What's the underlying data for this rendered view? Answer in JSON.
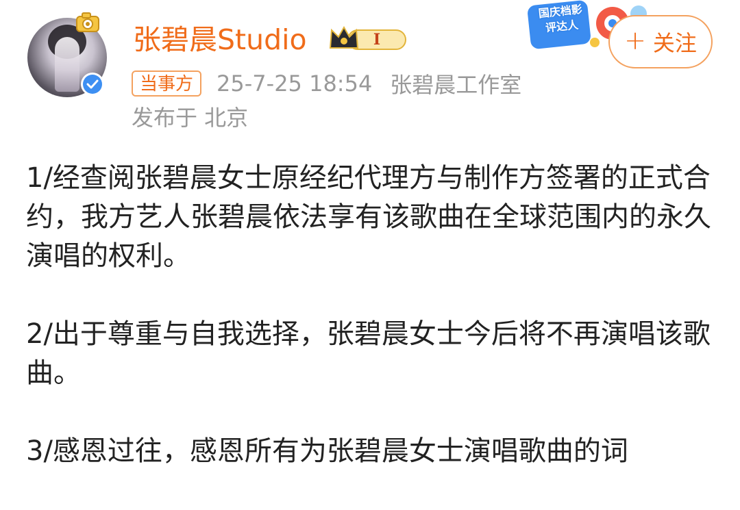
{
  "post": {
    "username": "张碧晨Studio",
    "level_badge": "I",
    "party_badge": "当事方",
    "time": "25-7-25 18:54",
    "source": "张碧晨工作室",
    "location": "发布于 北京",
    "follow_label": "关注",
    "follow_plus": "+",
    "paragraphs": [
      "1/经查阅张碧晨女士原经纪代理方与制作方签署的正式合约，我方艺人张碧晨依法享有该歌曲在全球范围内的永久演唱的权利。",
      "2/出于尊重与自我选择，张碧晨女士今后将不再演唱该歌曲。",
      "3/感恩过往，感恩所有为张碧晨女士演唱歌曲的词"
    ]
  },
  "promo": {
    "text": "国庆档影评达人"
  },
  "colors": {
    "accent": "#f06c1a",
    "border_accent": "#f4a15e",
    "meta_gray": "#999999",
    "body_text": "#222222",
    "verify_blue": "#3d8ff2"
  },
  "icons": {
    "avatar": "avatar",
    "verify": "verified-check-icon",
    "camera": "camera-icon",
    "crown": "crown-icon"
  }
}
